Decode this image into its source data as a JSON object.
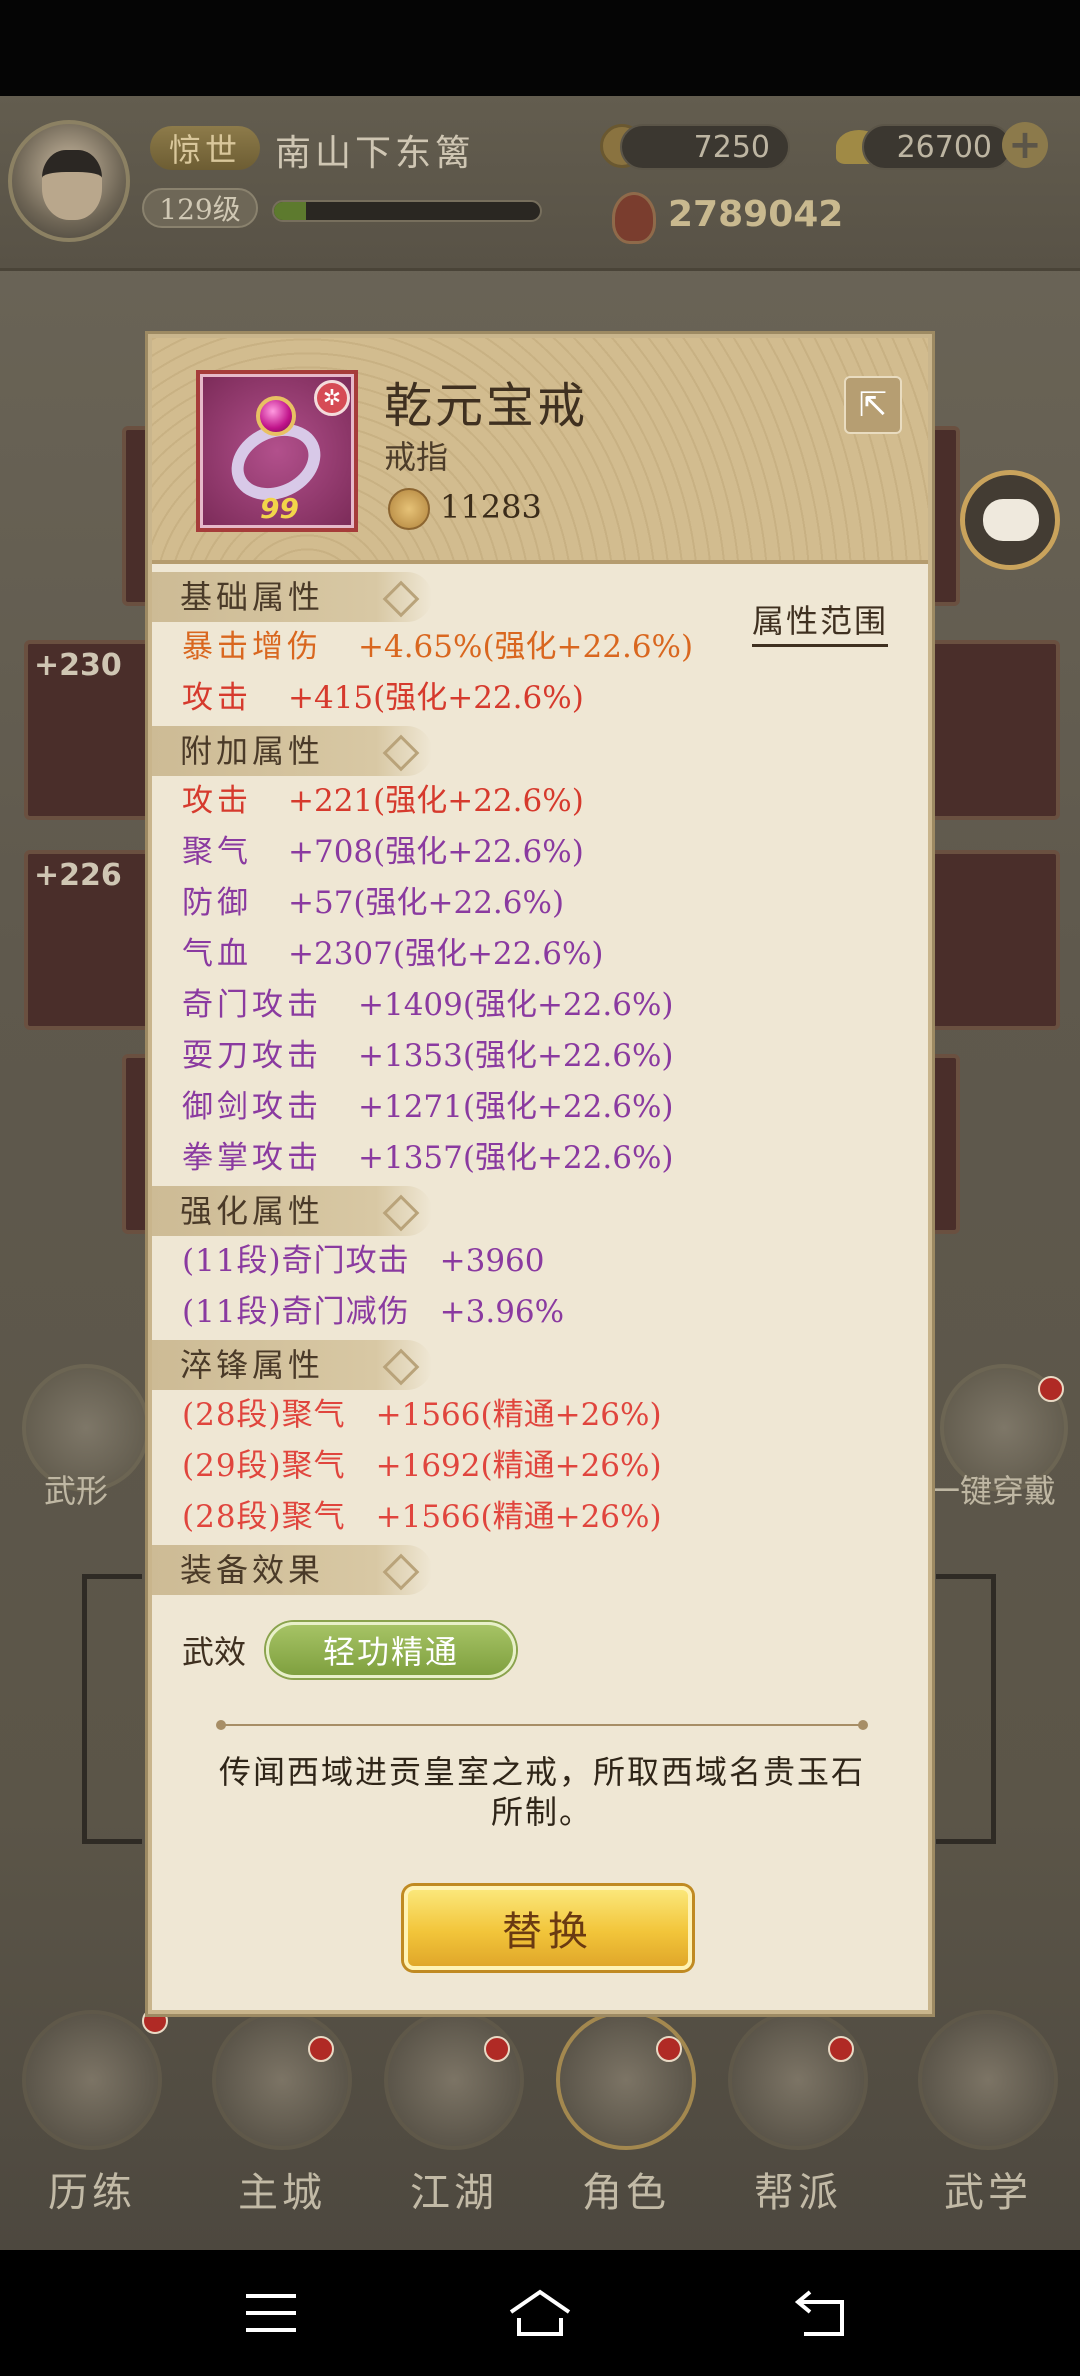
{
  "header": {
    "title_badge": "惊世",
    "player_name": "南山下东篱",
    "level": "129级",
    "exp_progress": 0.12,
    "copper": "7250",
    "gold": "26700",
    "power": "2789042"
  },
  "background": {
    "slots_left": [
      "+230",
      "+226"
    ],
    "wuxing_label": "武形",
    "equip_all_label": "一键穿戴"
  },
  "nav": {
    "items": [
      {
        "label": "历练",
        "icon": "scroll-icon"
      },
      {
        "label": "主城",
        "icon": "city-gate-icon"
      },
      {
        "label": "江湖",
        "icon": "sword-icon"
      },
      {
        "label": "角色",
        "icon": "character-icon"
      },
      {
        "label": "帮派",
        "icon": "guild-icon"
      },
      {
        "label": "武学",
        "icon": "martial-scroll-icon"
      }
    ]
  },
  "item": {
    "name": "乾元宝戒",
    "type": "戒指",
    "score": "11283",
    "grade": "99",
    "range_link": "属性范围"
  },
  "sections": {
    "base": {
      "title": "基础属性",
      "rows": [
        {
          "key": "暴击增伤",
          "value": "+4.65%(强化+22.6%)"
        },
        {
          "key": "攻击",
          "value": "+415(强化+22.6%)"
        }
      ]
    },
    "extra": {
      "title": "附加属性",
      "rows": [
        {
          "key": "攻击",
          "value": "+221(强化+22.6%)"
        },
        {
          "key": "聚气",
          "value": "+708(强化+22.6%)"
        },
        {
          "key": "防御",
          "value": "+57(强化+22.6%)"
        },
        {
          "key": "气血",
          "value": "+2307(强化+22.6%)"
        },
        {
          "key": "奇门攻击",
          "value": "+1409(强化+22.6%)"
        },
        {
          "key": "耍刀攻击",
          "value": "+1353(强化+22.6%)"
        },
        {
          "key": "御剑攻击",
          "value": "+1271(强化+22.6%)"
        },
        {
          "key": "拳掌攻击",
          "value": "+1357(强化+22.6%)"
        }
      ]
    },
    "enhance": {
      "title": "强化属性",
      "rows": [
        {
          "key": "(11段)奇门攻击",
          "value": "+3960"
        },
        {
          "key": "(11段)奇门减伤",
          "value": "+3.96%"
        }
      ]
    },
    "temper": {
      "title": "淬锋属性",
      "rows": [
        {
          "key": "(28段)聚气",
          "value": "+1566(精通+26%)"
        },
        {
          "key": "(29段)聚气",
          "value": "+1692(精通+26%)"
        },
        {
          "key": "(28段)聚气",
          "value": "+1566(精通+26%)"
        }
      ]
    },
    "effect": {
      "title": "装备效果",
      "label": "武效",
      "pill": "轻功精通"
    }
  },
  "description": "传闻西域进贡皇室之戒，所取西域名贵玉石所制。",
  "replace_label": "替换",
  "colors": {
    "orange": "#d9671f",
    "red": "#d63a2d",
    "purple": "#8a3aa0",
    "pill_green": "#8aa34d",
    "button_gold": "#f2c53a"
  }
}
